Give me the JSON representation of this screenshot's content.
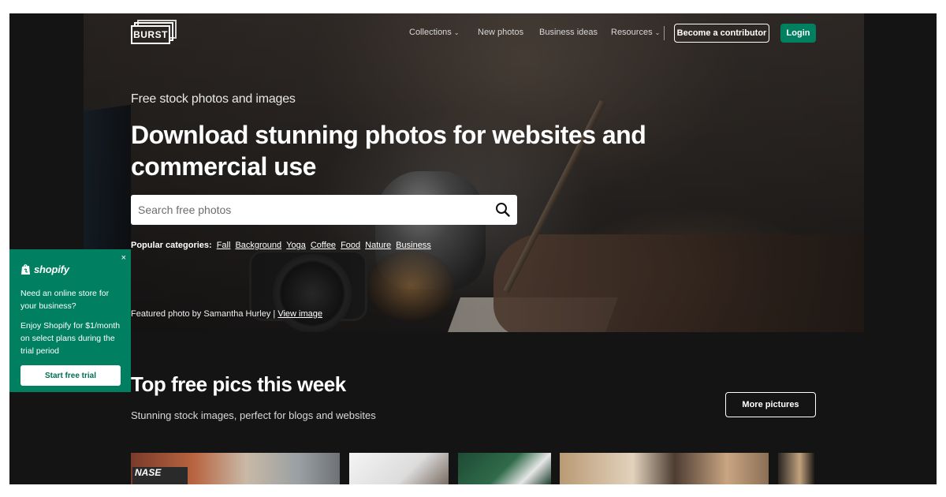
{
  "nav": {
    "logo_text": "BURST",
    "links": [
      {
        "label": "Collections",
        "has_caret": true
      },
      {
        "label": "New photos",
        "has_caret": false
      },
      {
        "label": "Business ideas",
        "has_caret": false
      },
      {
        "label": "Resources",
        "has_caret": true
      }
    ],
    "caret_glyph": "⌄",
    "contributor_label": "Become a contributor",
    "login_label": "Login"
  },
  "hero": {
    "eyebrow": "Free stock photos and images",
    "headline": "Download stunning photos for websites and commercial use",
    "search_placeholder": "Search free photos",
    "search_icon": "search-icon",
    "popular_label": "Popular categories:",
    "popular_categories": [
      "Fall",
      "Background",
      "Yoga",
      "Coffee",
      "Food",
      "Nature",
      "Business"
    ],
    "featured_text": "Featured photo by Samantha Hurley |",
    "featured_link": "View image"
  },
  "section": {
    "title": "Top free pics this week",
    "subtitle": "Stunning stock images, perfect for blogs and websites",
    "more_label": "More pictures",
    "thumbnail_sign_text": "NASE"
  },
  "promo": {
    "close_glyph": "×",
    "brand": "shopify",
    "question": "Need an online store for your business?",
    "offer": "Enjoy Shopify for $1/month on select plans during the trial period",
    "cta": "Start free trial"
  },
  "colors": {
    "accent_green": "#008060",
    "page_bg": "#141414",
    "text_white": "#ffffff"
  }
}
